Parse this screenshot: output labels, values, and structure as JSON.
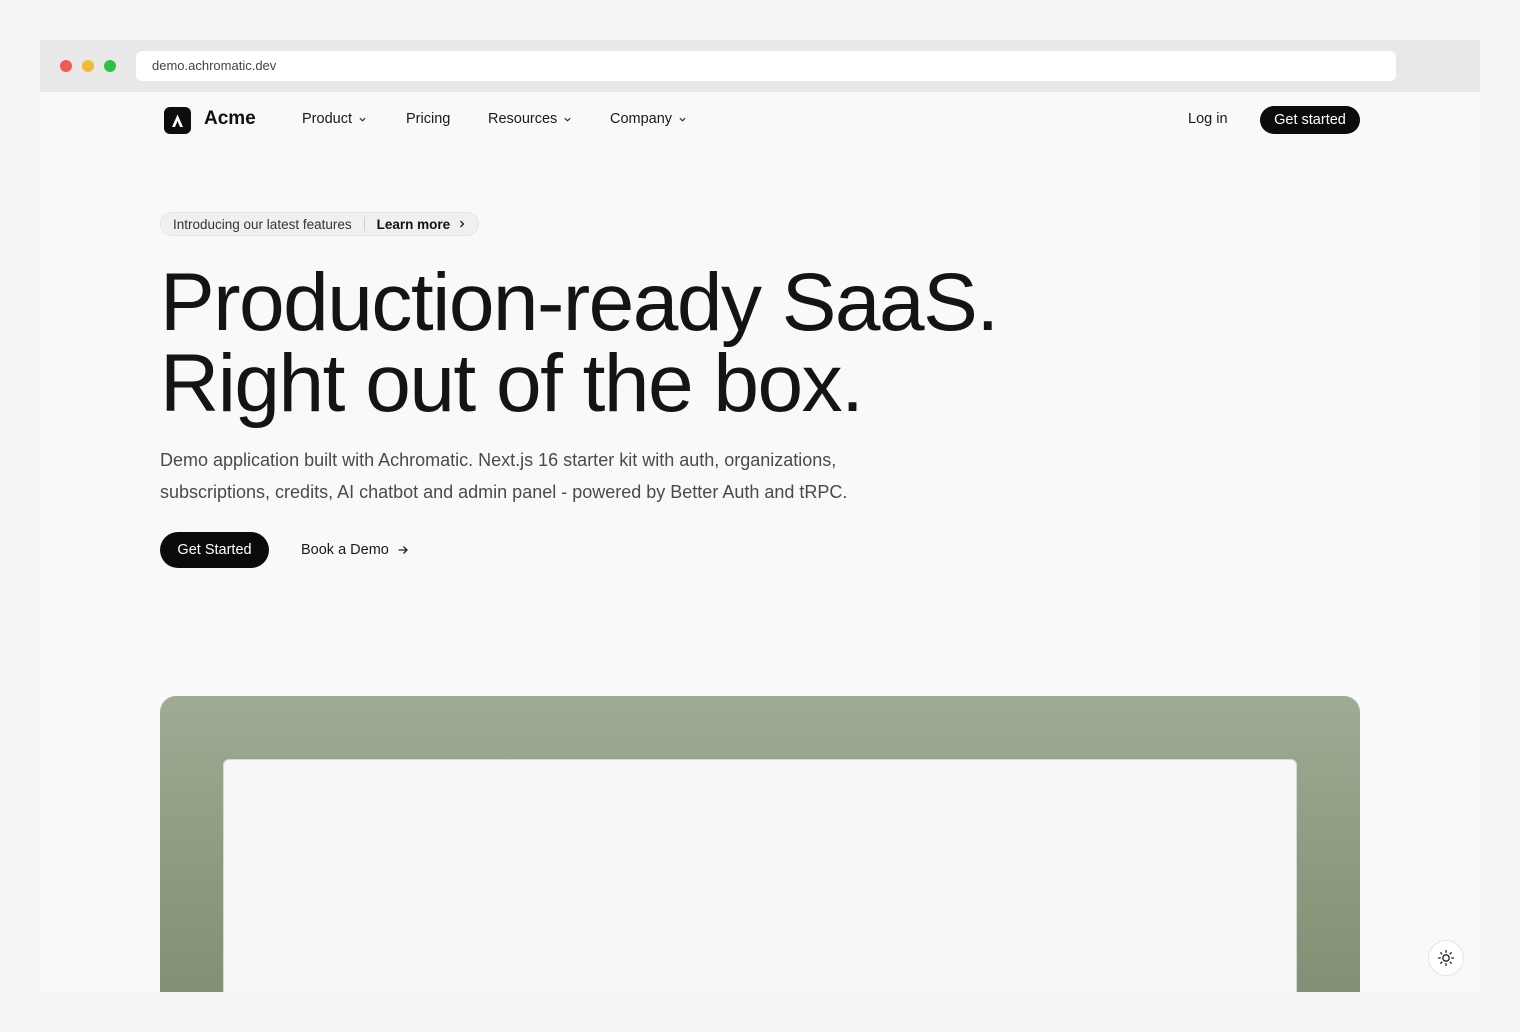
{
  "browser": {
    "url": "demo.achromatic.dev",
    "traffic_lights": {
      "red": "#ee5b54",
      "yellow": "#f5b93a",
      "green": "#2ec245"
    }
  },
  "nav": {
    "brand": "Acme",
    "items": [
      {
        "label": "Product",
        "has_dropdown": true
      },
      {
        "label": "Pricing",
        "has_dropdown": false
      },
      {
        "label": "Resources",
        "has_dropdown": true
      },
      {
        "label": "Company",
        "has_dropdown": true
      }
    ],
    "login_label": "Log in",
    "cta_label": "Get started"
  },
  "announcement": {
    "text": "Introducing our latest features",
    "link_label": "Learn more"
  },
  "hero": {
    "title_line1": "Production-ready SaaS.",
    "title_line2": "Right out of the box.",
    "subtitle_line1": "Demo application built with Achromatic. Next.js 16 starter kit with auth, organizations,",
    "subtitle_line2": "subscriptions, credits, AI chatbot and admin panel - powered by Better Auth and tRPC.",
    "primary_cta": "Get Started",
    "secondary_cta": "Book a Demo"
  },
  "colors": {
    "primary": "#0b0b0b",
    "showcase_green": "#95a289",
    "page_bg": "#f9f9f9"
  },
  "icons": {
    "logo": "acme-logo-icon",
    "dropdown": "chevron-down-icon",
    "arrow": "arrow-right-icon",
    "theme": "sun-icon"
  }
}
